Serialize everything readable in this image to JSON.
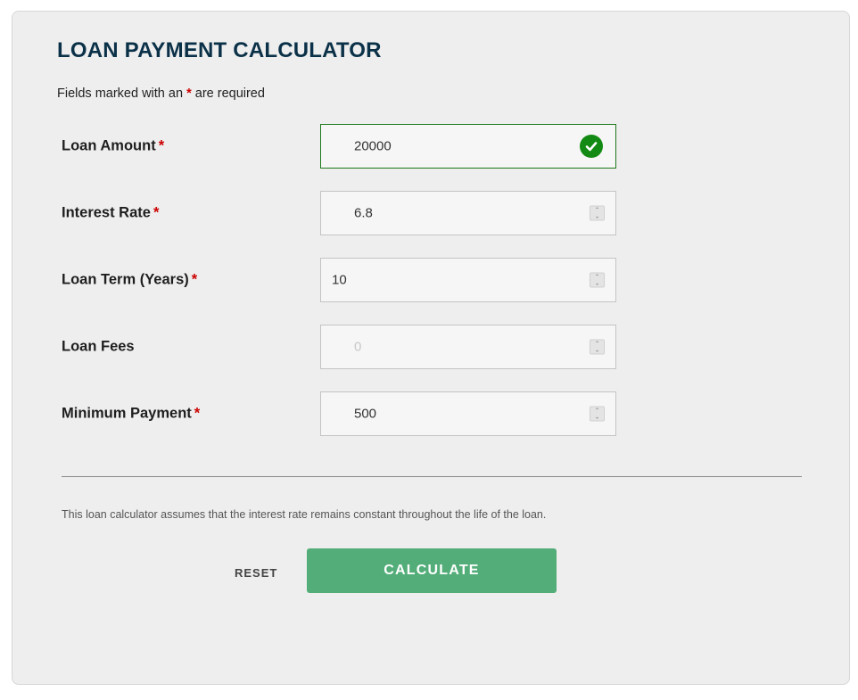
{
  "title": "LOAN PAYMENT CALCULATOR",
  "required_note": {
    "prefix": "Fields marked with an",
    "asterisk": "*",
    "suffix": "are required"
  },
  "fields": [
    {
      "label": "Loan Amount",
      "required": "*",
      "value": "20000",
      "status": "valid"
    },
    {
      "label": "Interest Rate",
      "required": "*",
      "value": "6.8"
    },
    {
      "label": "Loan Term (Years)",
      "required": "*",
      "value": "10"
    },
    {
      "label": "Loan Fees",
      "required": "",
      "placeholder": "0"
    },
    {
      "label": "Minimum Payment",
      "required": "*",
      "value": "500"
    }
  ],
  "disclaimer": "This loan calculator assumes that the interest rate remains constant throughout the life of the loan.",
  "buttons": {
    "reset": "RESET",
    "calculate": "CALCULATE"
  },
  "colors": {
    "title": "#0b3148",
    "required": "#cc0000",
    "valid": "#138a13",
    "calculate": "#53ad79"
  }
}
